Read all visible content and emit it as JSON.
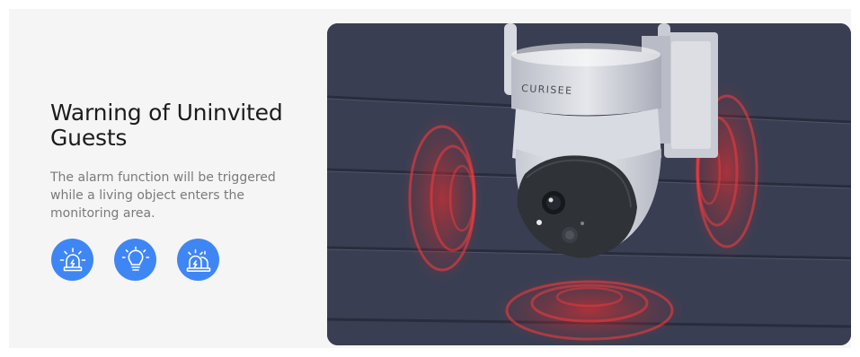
{
  "feature": {
    "title": "Warning of Uninvited Guests",
    "description": "The alarm function will be triggered while a living object enters the monitoring area."
  },
  "icons": [
    {
      "name": "alarm-siren-icon"
    },
    {
      "name": "light-bulb-icon"
    },
    {
      "name": "double-siren-icon"
    }
  ],
  "camera": {
    "brand": "CURISEE"
  },
  "colors": {
    "accent": "#3f86f5",
    "panel_bg": "#f5f5f5",
    "heading": "#1c1c1c",
    "body_text": "#7a7a7a",
    "alert_red": "#e02a2a"
  }
}
